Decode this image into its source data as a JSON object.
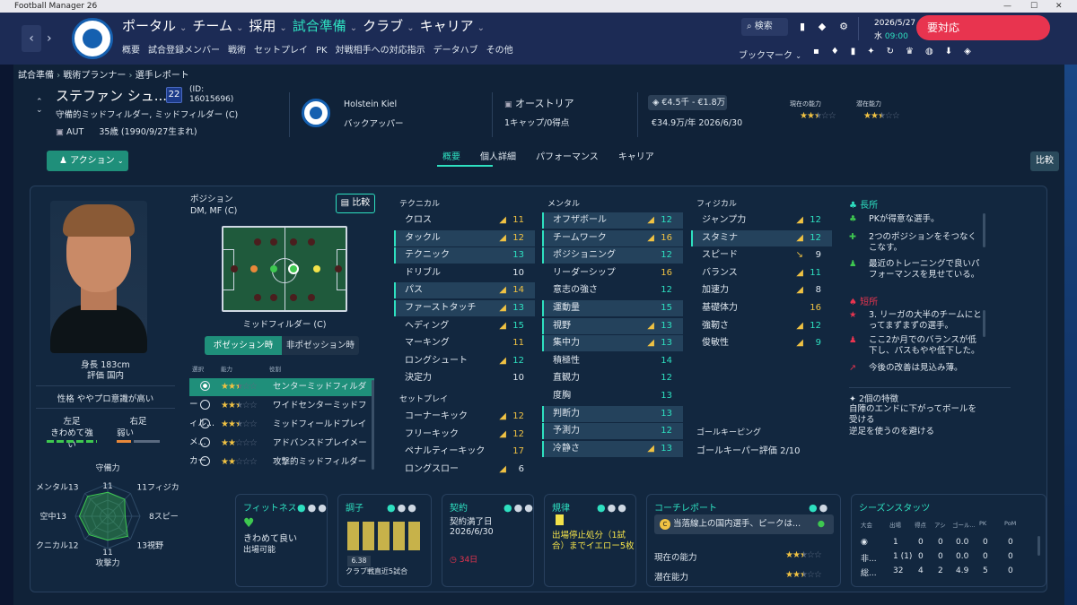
{
  "window": {
    "title": "Football Manager 26"
  },
  "nav": {
    "menu": [
      "ポータル",
      "チーム",
      "採用",
      "試合準備",
      "クラブ",
      "キャリア"
    ],
    "selected_index": 3,
    "submenu": [
      "概要",
      "試合登録メンバー",
      "戦術",
      "セットプレイ",
      "PK",
      "対戦相手への対応指示",
      "データハブ",
      "その他"
    ],
    "search_label": "検索",
    "date": "2026/5/27",
    "weekday": "水",
    "time": "09:00",
    "urgent_label": "要対応",
    "bookmark_label": "ブックマーク"
  },
  "breadcrumb": [
    "試合準備",
    "戦術プランナー",
    "選手レポート"
  ],
  "player": {
    "name": "ステファン シュ...",
    "number": "22",
    "id_label": "(ID:",
    "id_value": "16015696)",
    "positions": "守備的ミッドフィルダー, ミッドフィルダー (C)",
    "nation_code": "AUT",
    "age": "35歳 (1990/9/27生まれ)",
    "club": "Holstein Kiel",
    "club_role": "バックアッパー",
    "nationality": "オーストリア",
    "caps": "1キャップ/0得点",
    "value": "€4.5千 - €1.8万",
    "wage": "€34.9万/年 2026/6/30",
    "current_ability_label": "現在の能力",
    "potential_ability_label": "潜在能力",
    "current_stars": 2.5,
    "potential_stars": 2.5
  },
  "tabs": [
    "概要",
    "個人詳細",
    "パフォーマンス",
    "キャリア"
  ],
  "active_tab": 0,
  "buttons": {
    "action": "アクション",
    "compare": "比較",
    "compare2": "比較"
  },
  "profile": {
    "height": "身長 183cm",
    "rating": "評価 国内",
    "personality": "性格 ややプロ意識が高い",
    "left_foot_label": "左足",
    "left_foot_value": "きわめて強い",
    "right_foot_label": "右足",
    "right_foot_value": "弱い"
  },
  "radar": {
    "labels": [
      "守備力",
      "フィジカル",
      "スピード",
      "視野",
      "攻撃力",
      "テクニカル",
      "空中",
      "メンタル"
    ],
    "values": [
      "11",
      "11",
      "8",
      "13",
      "11",
      "12",
      "13",
      "13"
    ]
  },
  "position_panel": {
    "title": "ポジション",
    "subtitle": "DM, MF (C)",
    "selected_label": "ミッドフィルダー (C)",
    "toggle_on": "ポゼッション時",
    "toggle_off": "非ポゼッション時",
    "col_select": "選択",
    "col_ability": "能力",
    "col_role": "役割",
    "roles": [
      {
        "name": "センターミッドフィルダー",
        "stars": 2.5
      },
      {
        "name": "ワイドセンターミッドフィル...",
        "stars": 2.5
      },
      {
        "name": "ミッドフィールドプレイメ...",
        "stars": 2.5
      },
      {
        "name": "アドバンスドプレイメーカー",
        "stars": 2.0
      },
      {
        "name": "攻撃的ミッドフィルダー",
        "stars": 2.0
      }
    ]
  },
  "attributes": {
    "technical_title": "テクニカル",
    "technical": [
      {
        "name": "クロス",
        "value": "11"
      },
      {
        "name": "タックル",
        "value": "12"
      },
      {
        "name": "テクニック",
        "value": "13"
      },
      {
        "name": "ドリブル",
        "value": "10"
      },
      {
        "name": "パス",
        "value": "14"
      },
      {
        "name": "ファーストタッチ",
        "value": "13"
      },
      {
        "name": "ヘディング",
        "value": "15"
      },
      {
        "name": "マーキング",
        "value": "11"
      },
      {
        "name": "ロングシュート",
        "value": "12"
      },
      {
        "name": "決定力",
        "value": "10"
      }
    ],
    "setpiece_title": "セットプレイ",
    "setpiece": [
      {
        "name": "コーナーキック",
        "value": "12"
      },
      {
        "name": "フリーキック",
        "value": "12"
      },
      {
        "name": "ペナルティーキック",
        "value": "17"
      },
      {
        "name": "ロングスロー",
        "value": "6"
      }
    ],
    "mental_title": "メンタル",
    "mental": [
      {
        "name": "オフザボール",
        "value": "12"
      },
      {
        "name": "チームワーク",
        "value": "16"
      },
      {
        "name": "ポジショニング",
        "value": "12"
      },
      {
        "name": "リーダーシップ",
        "value": "16"
      },
      {
        "name": "意志の強さ",
        "value": "12"
      },
      {
        "name": "運動量",
        "value": "15"
      },
      {
        "name": "視野",
        "value": "13"
      },
      {
        "name": "集中力",
        "value": "13"
      },
      {
        "name": "積極性",
        "value": "14"
      },
      {
        "name": "直観力",
        "value": "12"
      },
      {
        "name": "度胸",
        "value": "13"
      },
      {
        "name": "判断力",
        "value": "13"
      },
      {
        "name": "予測力",
        "value": "12"
      },
      {
        "name": "冷静さ",
        "value": "13"
      }
    ],
    "physical_title": "フィジカル",
    "physical": [
      {
        "name": "ジャンプ力",
        "value": "12"
      },
      {
        "name": "スタミナ",
        "value": "12"
      },
      {
        "name": "スピード",
        "value": "9"
      },
      {
        "name": "バランス",
        "value": "11"
      },
      {
        "name": "加速力",
        "value": "8"
      },
      {
        "name": "基礎体力",
        "value": "16"
      },
      {
        "name": "強靭さ",
        "value": "12"
      },
      {
        "name": "俊敏性",
        "value": "9"
      }
    ],
    "goalkeeping_title": "ゴールキーピング",
    "goalkeeping_rating": "ゴールキーパー評価 2/10"
  },
  "strengths": {
    "title": "長所",
    "items": [
      "PKが得意な選手。",
      "2つのポジションをそつなくこなす。",
      "最近のトレーニングで良いパフォーマンスを見せている。"
    ]
  },
  "weaknesses": {
    "title": "短所",
    "items": [
      "3. リーガの大半のチームにとってまずまずの選手。",
      "ここ2か月でのバランスが低下し、パスもやや低下した。",
      "今後の改善は見込み薄。"
    ]
  },
  "traits": {
    "title": "2個の特徴",
    "items": [
      "自陣のエンドに下がってボールを受ける",
      "逆足を使うのを避ける"
    ]
  },
  "bottom": {
    "fitness_title": "フィットネス",
    "fitness_value": "きわめて良い",
    "fitness_status": "出場可能",
    "form_title": "調子",
    "form_rating": "6.38",
    "form_caption": "クラブ戦直近5試合",
    "contract_title": "契約",
    "contract_label": "契約満了日",
    "contract_date": "2026/6/30",
    "contract_days": "34日",
    "discipline_title": "規律",
    "discipline_text": "出場停止処分（1試合）までイエロー5枚",
    "coach_title": "コーチレポート",
    "coach_text": "当落線上の国内選手、ピークは...",
    "coach_current_label": "現在の能力",
    "coach_potential_label": "潜在能力",
    "season_title": "シーズンスタッツ",
    "season_headers": [
      "大会",
      "出場",
      "得点",
      "アシ",
      "ゴール...",
      "PK",
      "PoM"
    ],
    "season_rows": [
      [
        "",
        "1",
        "0",
        "0",
        "0.0",
        "0",
        "0"
      ],
      [
        "非...",
        "1 (1)",
        "0",
        "0",
        "0.0",
        "0",
        "0"
      ],
      [
        "総...",
        "32",
        "4",
        "2",
        "4.9",
        "5",
        "0"
      ]
    ]
  },
  "colors": {
    "accent": "#2ee0c0",
    "urgent": "#e8344f",
    "star": "#f0c243",
    "background": "#102238"
  }
}
